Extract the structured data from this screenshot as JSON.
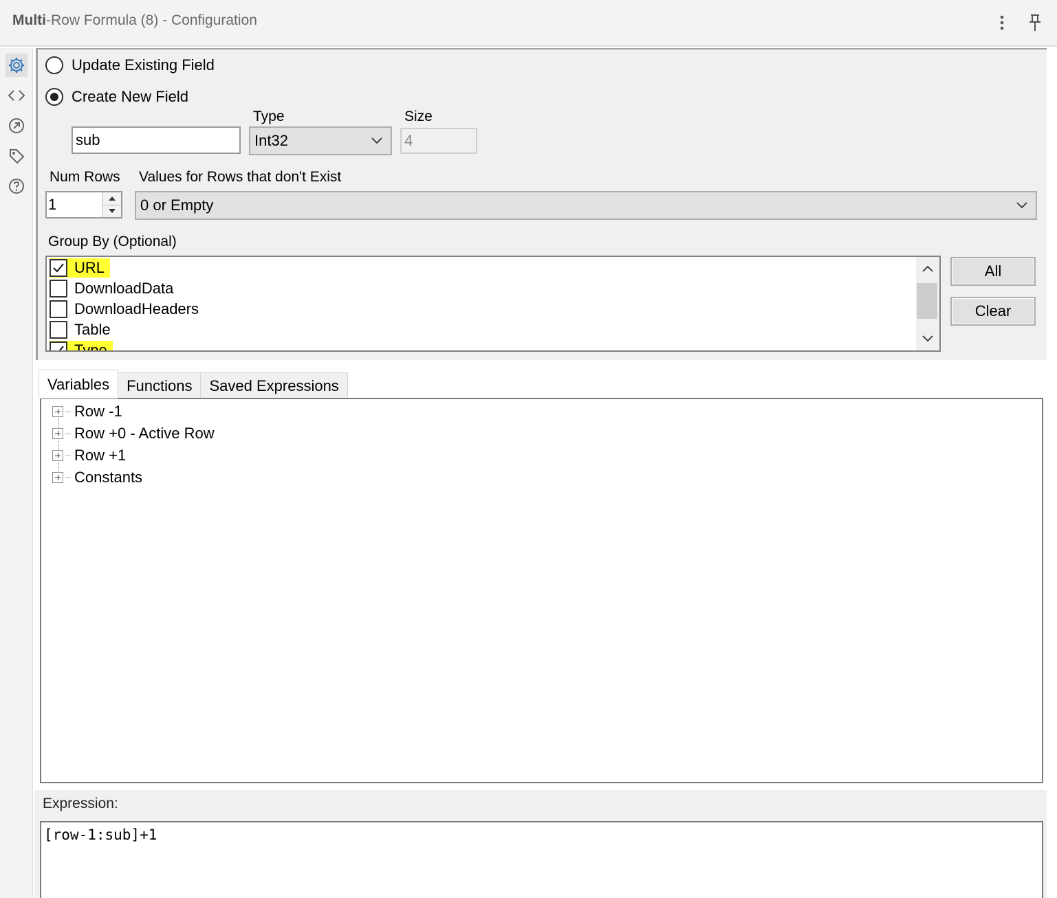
{
  "window": {
    "title_bold": "Multi",
    "title_rest": "-Row Formula (8) - Configuration",
    "menu_icon": "vertical-dots-icon",
    "pin_icon": "pin-icon"
  },
  "rail": {
    "icons": [
      "gear-icon",
      "code-icon",
      "annotation-icon",
      "tag-icon",
      "help-icon"
    ],
    "accent_color": "#3b7bbf"
  },
  "mode": {
    "update_label": "Update Existing Field",
    "create_label": "Create New  Field",
    "selected": "create"
  },
  "field": {
    "name_value": "sub",
    "type_label": "Type",
    "type_value": "Int32",
    "size_label": "Size",
    "size_value": "4"
  },
  "rows": {
    "num_rows_label": "Num Rows",
    "num_rows_value": "1",
    "values_label": "Values for Rows that don't Exist",
    "values_value": "0 or Empty"
  },
  "group_by": {
    "label": "Group By (Optional)",
    "items": [
      {
        "label": "URL",
        "checked": true,
        "highlighted": true
      },
      {
        "label": "DownloadData",
        "checked": false,
        "highlighted": false
      },
      {
        "label": "DownloadHeaders",
        "checked": false,
        "highlighted": false
      },
      {
        "label": "Table",
        "checked": false,
        "highlighted": false
      },
      {
        "label": "Type",
        "checked": true,
        "highlighted": true
      }
    ],
    "all_button": "All",
    "clear_button": "Clear",
    "highlight_color": "#ffff33"
  },
  "tabs": [
    {
      "label": "Variables",
      "active": true
    },
    {
      "label": "Functions",
      "active": false
    },
    {
      "label": "Saved Expressions",
      "active": false
    }
  ],
  "tree": {
    "items": [
      "Row -1",
      "Row +0 - Active Row",
      "Row +1",
      "Constants"
    ]
  },
  "expression": {
    "label": "Expression:",
    "value": "[row-1:sub]+1"
  }
}
